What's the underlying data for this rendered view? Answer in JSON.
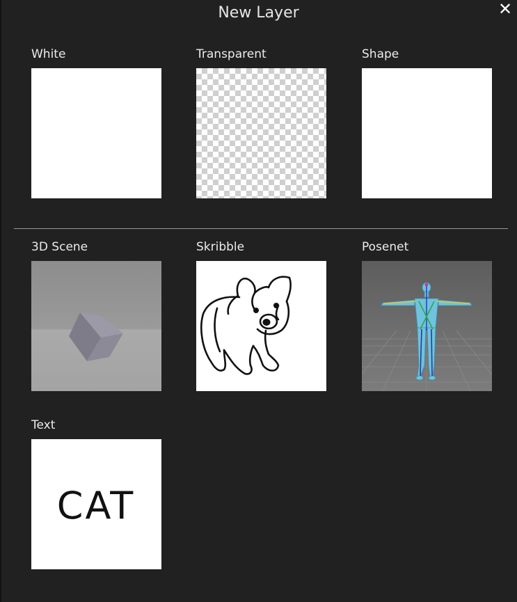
{
  "dialog": {
    "title": "New Layer",
    "close_symbol": "✕"
  },
  "options": [
    {
      "label": "White",
      "icon": "blank-white-preview"
    },
    {
      "label": "Transparent",
      "icon": "checkerboard-preview"
    },
    {
      "label": "Shape",
      "icon": "blank-white-preview"
    },
    {
      "label": "3D Scene",
      "icon": "cube-scene-preview"
    },
    {
      "label": "Skribble",
      "icon": "bear-sketch-preview"
    },
    {
      "label": "Posenet",
      "icon": "pose-figure-preview"
    },
    {
      "label": "Text",
      "icon": "text-preview"
    }
  ],
  "text_preview": {
    "sample": "CAT"
  },
  "colors": {
    "background": "#212121",
    "divider": "#9a9a9a",
    "thumb_white": "#ffffff"
  }
}
